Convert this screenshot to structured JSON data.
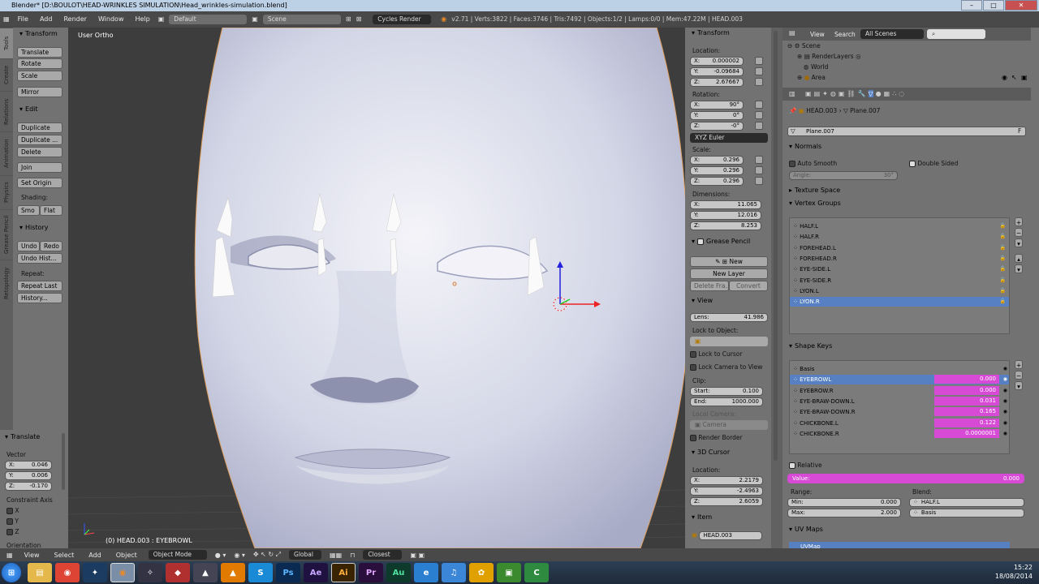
{
  "window": {
    "title": "Blender* [D:\\BOULOT\\HEAD-WRINKLES SIMULATION\\Head_wrinkles-simulation.blend]"
  },
  "infobar": {
    "menus": [
      "File",
      "Add",
      "Render",
      "Window",
      "Help"
    ],
    "layout": "Default",
    "scene": "Scene",
    "engine": "Cycles Render",
    "stats": "v2.71 | Verts:3822 | Faces:3746 | Tris:7492 | Objects:1/2 | Lamps:0/0 | Mem:47.22M | HEAD.003"
  },
  "toolshelf": {
    "tabs": [
      "Tools",
      "Create",
      "Relations",
      "Animation",
      "Physics",
      "Grease Pencil",
      "Retopology"
    ],
    "transform_header": "Transform",
    "translate": "Translate",
    "rotate": "Rotate",
    "scale": "Scale",
    "mirror": "Mirror",
    "edit_header": "Edit",
    "duplicate": "Duplicate",
    "duplicate_linked": "Duplicate ...",
    "delete": "Delete",
    "join": "Join",
    "set_origin": "Set Origin",
    "shading_label": "Shading:",
    "smooth": "Smo",
    "flat": "Flat",
    "history_header": "History",
    "undo": "Undo",
    "redo": "Redo",
    "undo_history": "Undo Hist...",
    "repeat_label": "Repeat:",
    "repeat_last": "Repeat Last",
    "history": "History..."
  },
  "operator": {
    "header": "Translate",
    "vector_label": "Vector",
    "x": "X:",
    "x_val": "0.046",
    "y": "Y:",
    "y_val": "0.006",
    "z": "Z:",
    "z_val": "-0.170",
    "constraint_label": "Constraint Axis",
    "cx": "X",
    "cy": "Y",
    "cz": "Z",
    "orientation": "Orientation"
  },
  "viewport": {
    "view_label": "User Ortho",
    "object_label": "(0) HEAD.003 : EYEBROWL"
  },
  "npanel": {
    "transform_header": "Transform",
    "location_label": "Location:",
    "loc": [
      [
        "X:",
        "0.000002"
      ],
      [
        "Y:",
        "-0.09684"
      ],
      [
        "Z:",
        "2.67667"
      ]
    ],
    "rotation_label": "Rotation:",
    "rot": [
      [
        "X:",
        "90°"
      ],
      [
        "Y:",
        "0°"
      ],
      [
        "Z:",
        "-0°"
      ]
    ],
    "rot_mode": "XYZ Euler",
    "scale_label": "Scale:",
    "scl": [
      [
        "X:",
        "0.296"
      ],
      [
        "Y:",
        "0.296"
      ],
      [
        "Z:",
        "0.296"
      ]
    ],
    "dimensions_label": "Dimensions:",
    "dim": [
      [
        "X:",
        "11.065"
      ],
      [
        "Y:",
        "12.016"
      ],
      [
        "Z:",
        "8.253"
      ]
    ],
    "grease_header": "Grease Pencil",
    "new": "New",
    "new_layer": "New Layer",
    "delete_frame": "Delete Fra...",
    "convert": "Convert",
    "view_header": "View",
    "lens_label": "Lens:",
    "lens": "41.986",
    "lock_object": "Lock to Object:",
    "lock_cursor": "Lock to Cursor",
    "lock_camera": "Lock Camera to View",
    "clip_label": "Clip:",
    "clip_start_label": "Start:",
    "clip_start": "0.100",
    "clip_end_label": "End:",
    "clip_end": "1000.000",
    "local_camera": "Local Camera:",
    "camera": "Camera",
    "render_border": "Render Border",
    "cursor_header": "3D Cursor",
    "cursor_location": "Location:",
    "cur": [
      [
        "X:",
        "2.2179"
      ],
      [
        "Y:",
        "-2.4963"
      ],
      [
        "Z:",
        "2.6059"
      ]
    ],
    "item_header": "Item",
    "item_name": "HEAD.003"
  },
  "outliner": {
    "view": "View",
    "search": "Search",
    "scenes": "All Scenes",
    "items": [
      "Scene",
      "RenderLayers",
      "World",
      "Area"
    ]
  },
  "props": {
    "breadcrumb_obj": "HEAD.003",
    "breadcrumb_mesh": "Plane.007",
    "mesh_name": "Plane.007",
    "mesh_f": "F",
    "normals_header": "Normals",
    "auto_smooth": "Auto Smooth",
    "double_sided": "Double Sided",
    "angle_label": "Angle:",
    "angle_val": "30°",
    "texture_space": "Texture Space",
    "vertex_groups_header": "Vertex Groups",
    "vertex_groups": [
      "HALF.L",
      "HALF.R",
      "FOREHEAD.L",
      "FOREHEAD.R",
      "EYE-SIDE.L",
      "EYE-SIDE.R",
      "LYON.L",
      "LYON.R"
    ],
    "shape_keys_header": "Shape Keys",
    "shape_keys": [
      {
        "name": "Basis",
        "value": ""
      },
      {
        "name": "EYEBROWL",
        "value": "0.000"
      },
      {
        "name": "EYEBROW.R",
        "value": "0.000"
      },
      {
        "name": "EYE-BRAW-DOWN.L",
        "value": "0.031"
      },
      {
        "name": "EYE-BRAW-DOWN.R",
        "value": "0.165"
      },
      {
        "name": "CHICKBONE.L",
        "value": "0.122"
      },
      {
        "name": "CHICKBONE.R",
        "value": "0.0000001"
      }
    ],
    "relative": "Relative",
    "value_label": "Value:",
    "value": "0.000",
    "range_label": "Range:",
    "min_label": "Min:",
    "min": "0.000",
    "max_label": "Max:",
    "max": "2.000",
    "blend_label": "Blend:",
    "blend": "HALF.L",
    "basis": "Basis",
    "uvmaps_header": "UV Maps",
    "uvmap": "UVMap"
  },
  "bottombar": {
    "view": "View",
    "select": "Select",
    "add": "Add",
    "object": "Object",
    "mode": "Object Mode",
    "orientation": "Global",
    "snap": "Closest"
  },
  "taskbar": {
    "apps": [
      "Explorer",
      "Chrome",
      "Blender",
      "Daz",
      "Orange",
      "Autodesk",
      "VLC",
      "Skype",
      "Ps",
      "Ae",
      "Ai",
      "Pr",
      "Au",
      "Edge",
      "iTunes",
      "Flower",
      "Evernote",
      "Camtasia"
    ],
    "time": "15:22",
    "date": "18/08/2014"
  },
  "colors": {
    "selection": "#5680c2",
    "shape_value": "#d64ad6",
    "viewport_bg": "#3c3c3c"
  }
}
